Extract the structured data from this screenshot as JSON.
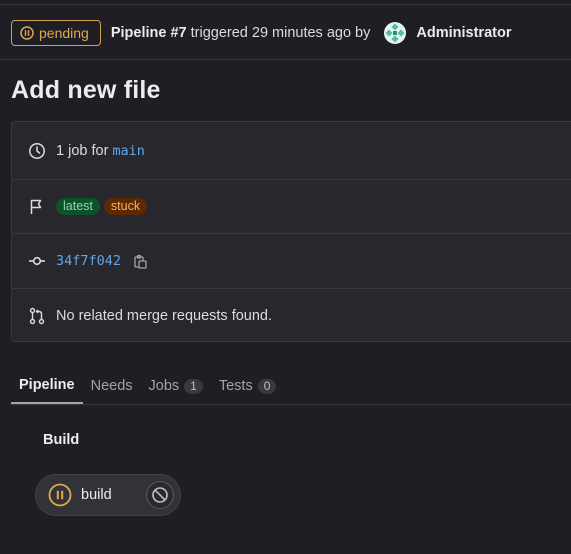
{
  "header": {
    "status": "pending",
    "pipeline_label": "Pipeline #7",
    "triggered_text": " triggered 29 minutes ago by ",
    "user": "Administrator"
  },
  "page_title": "Add new file",
  "info": {
    "jobs_text": "1 job for",
    "branch": "main",
    "tags": [
      "latest",
      "stuck"
    ],
    "commit_sha": "34f7f042",
    "merge_requests_text": "No related merge requests found."
  },
  "tabs": [
    {
      "label": "Pipeline",
      "count": null
    },
    {
      "label": "Needs",
      "count": null
    },
    {
      "label": "Jobs",
      "count": "1"
    },
    {
      "label": "Tests",
      "count": "0"
    }
  ],
  "stage": {
    "title": "Build",
    "job_name": "build"
  },
  "colors": {
    "pending": "#e0a94c",
    "link": "#63a6e9",
    "background": "#1f1e24"
  },
  "icons": {
    "status": "pause-circle-icon",
    "clock": "clock-icon",
    "flag": "flag-icon",
    "commit": "commit-icon",
    "copy": "copy-icon",
    "merge_request": "merge-request-icon",
    "cancel": "cancel-icon"
  }
}
